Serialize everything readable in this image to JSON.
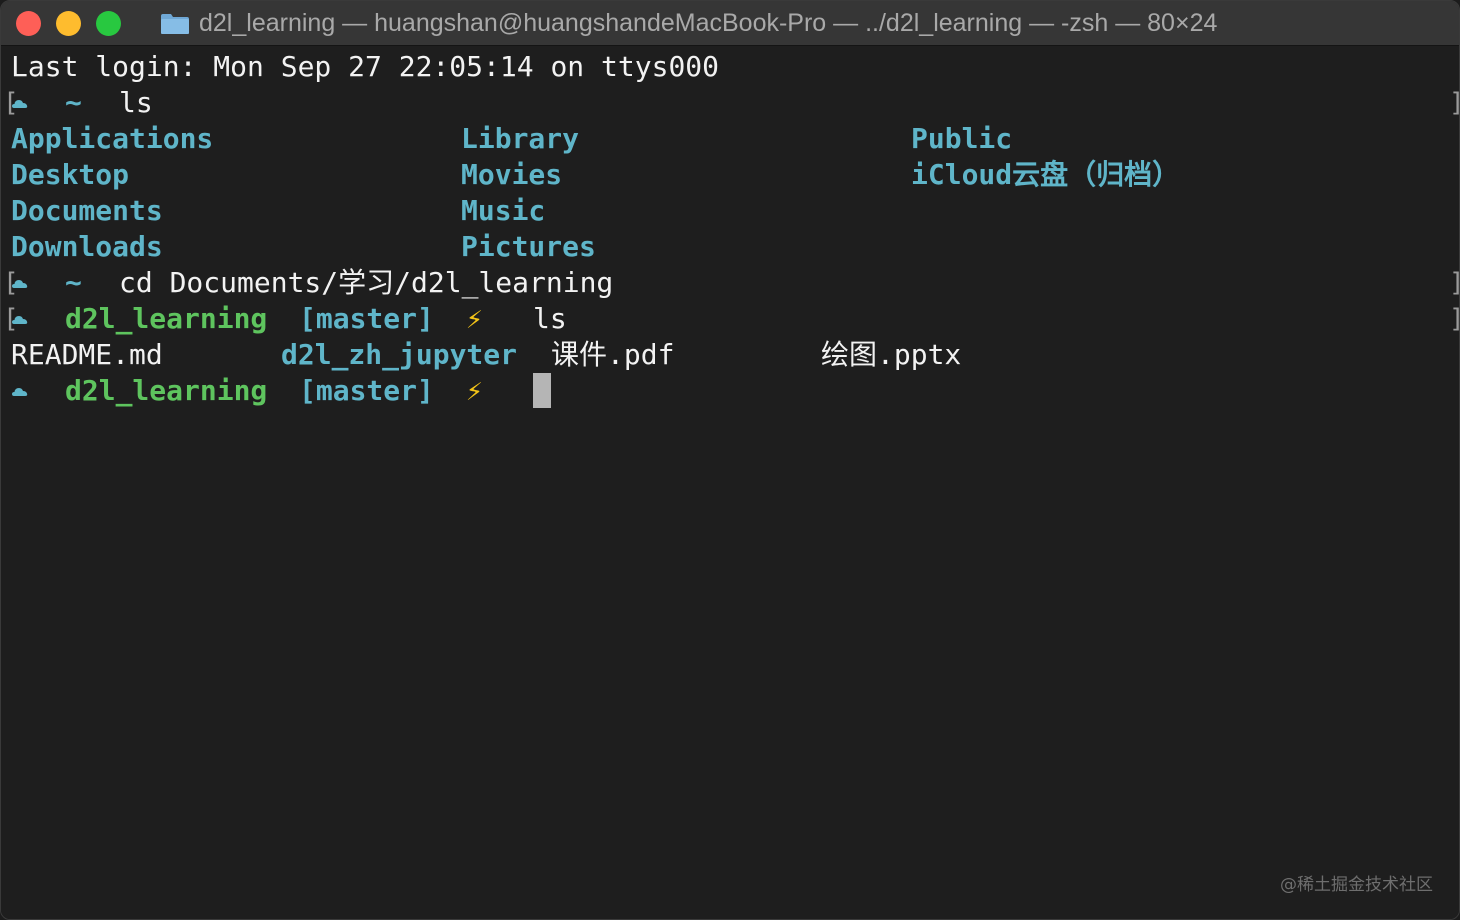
{
  "window": {
    "title": "d2l_learning — huangshan@huangshandeMacBook-Pro — ../d2l_learning — -zsh — 80×24",
    "icons": [
      "close-icon",
      "minimize-icon",
      "zoom-icon",
      "folder-icon"
    ],
    "colors": {
      "close": "#fe5f57",
      "minimize": "#febc2e",
      "zoom": "#28c840",
      "background": "#1e1e1e",
      "directory": "#5fb5c9",
      "prompt_dir": "#5ec45e",
      "bolt": "#f5c518"
    }
  },
  "terminal": {
    "last_login": "Last login: Mon Sep 27 22:05:14 on ttys000",
    "prompt1": {
      "bracket_open": "[",
      "icon": "cloud-icon",
      "dir": "~",
      "command": "ls",
      "bracket_close": "]"
    },
    "ls_home": {
      "col1": [
        "Applications",
        "Desktop",
        "Documents",
        "Downloads"
      ],
      "col2": [
        "Library",
        "Movies",
        "Music",
        "Pictures"
      ],
      "col3": [
        "Public",
        "iCloud云盘（归档）"
      ]
    },
    "prompt2": {
      "bracket_open": "[",
      "icon": "cloud-icon",
      "dir": "~",
      "command": "cd Documents/学习/d2l_learning",
      "bracket_close": "]"
    },
    "prompt3": {
      "bracket_open": "[",
      "icon": "cloud-icon",
      "dir": "d2l_learning",
      "branch": "[master]",
      "bolt": "⚡",
      "command": "ls",
      "bracket_close": "]"
    },
    "ls_d2l": {
      "file1": "README.md",
      "dir1": "d2l_zh_jupyter",
      "file2": "课件.pdf",
      "file3": "绘图.pptx"
    },
    "prompt4": {
      "icon": "cloud-icon",
      "dir": "d2l_learning",
      "branch": "[master]",
      "bolt": "⚡"
    }
  },
  "watermark": "@稀土掘金技术社区"
}
